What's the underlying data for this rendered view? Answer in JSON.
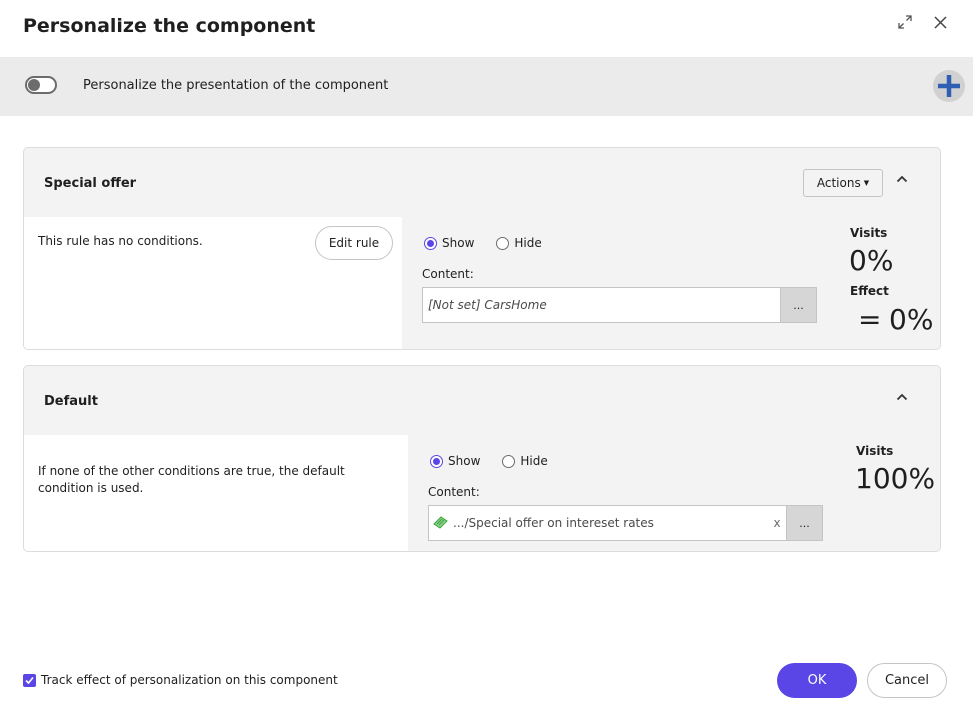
{
  "dialog": {
    "title": "Personalize the component"
  },
  "toolbar": {
    "toggle_label": "Personalize the presentation of the component",
    "toggle_on": false
  },
  "rules": [
    {
      "title": "Special offer",
      "actions_label": "Actions",
      "condition_text": "This rule has no conditions.",
      "edit_rule_label": "Edit rule",
      "show_label": "Show",
      "hide_label": "Hide",
      "selected": "Show",
      "content_label": "Content:",
      "content_value": "[Not set] CarsHome",
      "browse_label": "...",
      "visits_label": "Visits",
      "visits_value": "0%",
      "effect_label": "Effect",
      "effect_sign": "=",
      "effect_value": "0%"
    },
    {
      "title": "Default",
      "condition_text": "If none of the other conditions are true, the default condition is used.",
      "show_label": "Show",
      "hide_label": "Hide",
      "selected": "Show",
      "content_label": "Content:",
      "content_value": ".../Special offer on intereset rates",
      "clear_label": "x",
      "browse_label": "...",
      "visits_label": "Visits",
      "visits_value": "100%"
    }
  ],
  "footer": {
    "track_label": "Track effect of personalization on this component",
    "track_checked": true,
    "ok_label": "OK",
    "cancel_label": "Cancel"
  },
  "colors": {
    "accent": "#5a45e6",
    "toolbar_bg": "#ebebeb",
    "add_icon": "#2f5fb3",
    "content_icon": "#3aa43a"
  },
  "icons": [
    "expand-icon",
    "close-icon",
    "plus-icon",
    "chevron-up-icon",
    "caret-down-icon",
    "content-item-icon",
    "check-icon"
  ]
}
